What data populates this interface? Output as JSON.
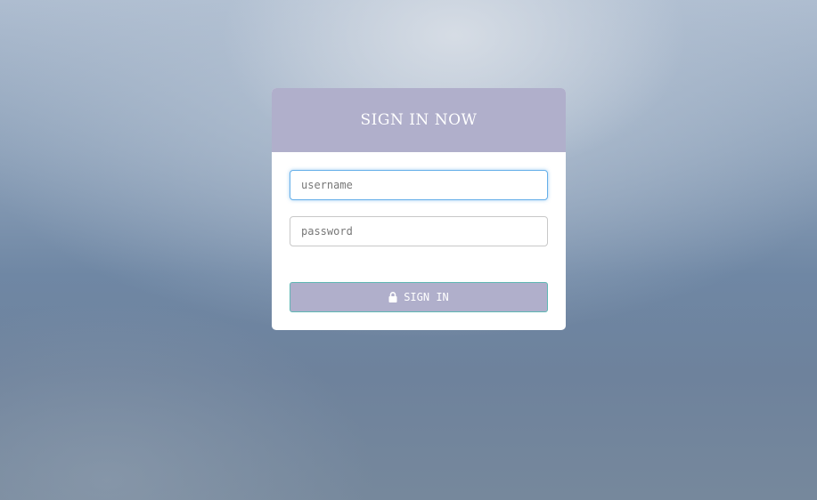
{
  "login": {
    "title": "SIGN IN NOW",
    "username": {
      "value": "",
      "placeholder": "username"
    },
    "password": {
      "value": "",
      "placeholder": "password"
    },
    "submit_label": "SIGN IN",
    "submit_icon": "lock-icon"
  },
  "colors": {
    "header_bg": "#b0afcb",
    "button_bg": "#b0afcb",
    "button_border": "#5fb7b4",
    "focus_border": "#66afe9",
    "card_bg": "#ffffff"
  }
}
